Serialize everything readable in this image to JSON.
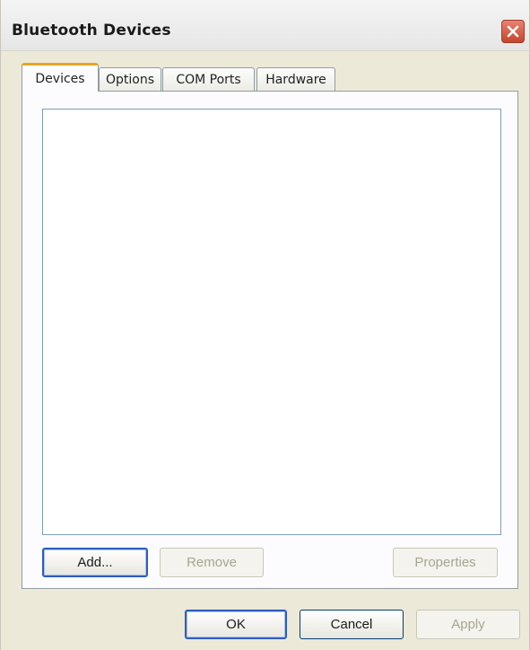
{
  "window": {
    "title": "Bluetooth Devices"
  },
  "tabs": [
    {
      "label": "Devices",
      "active": true
    },
    {
      "label": "Options",
      "active": false
    },
    {
      "label": "COM Ports",
      "active": false
    },
    {
      "label": "Hardware",
      "active": false
    }
  ],
  "device_list": {
    "items": []
  },
  "panel_buttons": {
    "add": "Add...",
    "remove": "Remove",
    "properties": "Properties"
  },
  "dialog_buttons": {
    "ok": "OK",
    "cancel": "Cancel",
    "apply": "Apply"
  },
  "colors": {
    "dialog_background": "#ece9d8",
    "active_tab_highlight": "#e6a623",
    "default_button_border": "#2d5dbf",
    "close_button": "#c4452e",
    "disabled_text": "#a7a592"
  },
  "icons": {
    "close": "close-x-icon"
  }
}
